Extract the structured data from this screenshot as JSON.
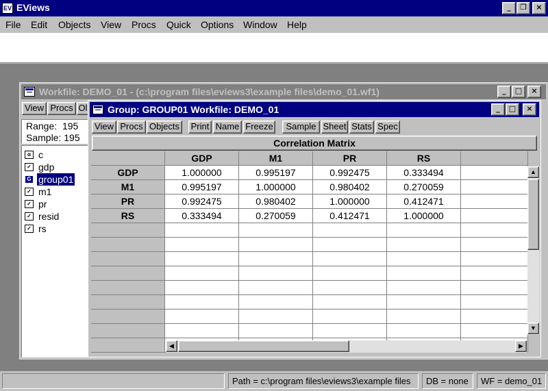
{
  "app": {
    "title": "EViews",
    "caption_buttons": {
      "minimize": "_",
      "restore": "❐",
      "close": "×"
    }
  },
  "menu": [
    "File",
    "Edit",
    "Objects",
    "View",
    "Procs",
    "Quick",
    "Options",
    "Window",
    "Help"
  ],
  "workfile": {
    "title": "Workfile: DEMO_01 - (c:\\program files\\eviews3\\example files\\demo_01.wf1)",
    "toolbar": [
      "View",
      "Procs",
      "Ol"
    ],
    "range_label": "Range:",
    "range_value": "195",
    "sample_label": "Sample:",
    "sample_value": "195",
    "items": [
      {
        "name": "c",
        "icon": "coef-icon",
        "glyph": "α",
        "selected": false
      },
      {
        "name": "gdp",
        "icon": "series-icon",
        "glyph": "✓",
        "selected": false
      },
      {
        "name": "group01",
        "icon": "group-icon",
        "glyph": "G",
        "selected": true
      },
      {
        "name": "m1",
        "icon": "series-icon",
        "glyph": "✓",
        "selected": false
      },
      {
        "name": "pr",
        "icon": "series-icon",
        "glyph": "✓",
        "selected": false
      },
      {
        "name": "resid",
        "icon": "series-icon",
        "glyph": "✓",
        "selected": false
      },
      {
        "name": "rs",
        "icon": "series-icon",
        "glyph": "✓",
        "selected": false
      }
    ]
  },
  "group": {
    "title": "Group: GROUP01   Workfile: DEMO_01",
    "toolbar": [
      "View",
      "Procs",
      "Objects",
      "Print",
      "Name",
      "Freeze",
      "Sample",
      "Sheet",
      "Stats",
      "Spec"
    ],
    "matrix_title": "Correlation Matrix",
    "columns": [
      "GDP",
      "M1",
      "PR",
      "RS"
    ],
    "rows": [
      {
        "label": "GDP",
        "values": [
          "1.000000",
          "0.995197",
          "0.992475",
          "0.333494"
        ]
      },
      {
        "label": "M1",
        "values": [
          "0.995197",
          "1.000000",
          "0.980402",
          "0.270059"
        ]
      },
      {
        "label": "PR",
        "values": [
          "0.992475",
          "0.980402",
          "1.000000",
          "0.412471"
        ]
      },
      {
        "label": "RS",
        "values": [
          "0.333494",
          "0.270059",
          "0.412471",
          "1.000000"
        ]
      }
    ]
  },
  "status": {
    "path": "Path = c:\\program files\\eviews3\\example files",
    "db": "DB = none",
    "wf": "WF = demo_01"
  },
  "colors": {
    "title_active": "#000080",
    "title_inactive": "#808080",
    "face": "#c0c0c0",
    "desktop": "#808080"
  }
}
